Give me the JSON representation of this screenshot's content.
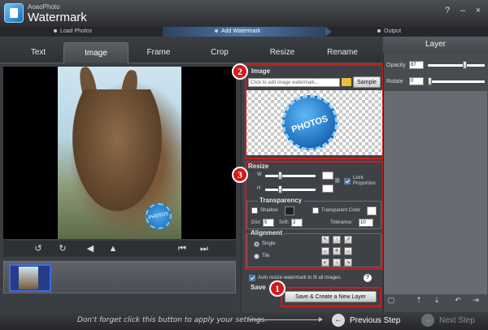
{
  "app": {
    "brand_small": "AoaoPhoto",
    "brand_big": "Watermark"
  },
  "window_buttons": {
    "help": "?",
    "minimize": "–",
    "close": "×"
  },
  "steps": [
    {
      "label": "Load Photos"
    },
    {
      "label": "Add Watermark"
    },
    {
      "label": "Output"
    }
  ],
  "tabs": [
    {
      "label": "Text"
    },
    {
      "label": "Image"
    },
    {
      "label": "Frame"
    },
    {
      "label": "Crop"
    },
    {
      "label": "Resize"
    },
    {
      "label": "Rename"
    }
  ],
  "active_tab": "Image",
  "preview": {
    "mini_badge_text": "PHOTOS"
  },
  "image_section": {
    "title": "Image",
    "input_placeholder": "Click to add image watermark...",
    "sample_button": "Sample",
    "badge_text": "PHOTOS"
  },
  "resize_section": {
    "title": "Resize",
    "w_label": "W",
    "h_label": "H",
    "lock_label": "Lock Proportion",
    "lock_checked": true
  },
  "transparency_section": {
    "title": "Transparency",
    "shadow_label": "Shadow",
    "transparent_color_label": "Transparent Color",
    "dist_label": "Dist:",
    "dist_value": "5",
    "soft_label": "Soft:",
    "soft_value": "2",
    "tolerance_label": "Tolerance:",
    "tolerance_value": "10"
  },
  "alignment_section": {
    "title": "Alignment",
    "single_label": "Single",
    "tile_label": "Tile",
    "selected": "Single"
  },
  "auto_resize_label": "Auto resize watermark to fit all images.",
  "save_section_title": "Save",
  "save_button": "Save & Create a New Layer",
  "callouts": [
    "1",
    "2",
    "3"
  ],
  "layer_panel": {
    "title": "Layer",
    "opacity_label": "Opacity",
    "opacity_value": "87",
    "rotate_label": "Rotate",
    "rotate_value": "0"
  },
  "bottom": {
    "hint": "Don't forget click this button to apply your settings.",
    "previous_step": "Previous Step",
    "next_step": "Next Step"
  },
  "colors": {
    "callout_red": "#d21a1a",
    "active_step": "#4e78ab",
    "badge_blue": "#1a66b5"
  }
}
